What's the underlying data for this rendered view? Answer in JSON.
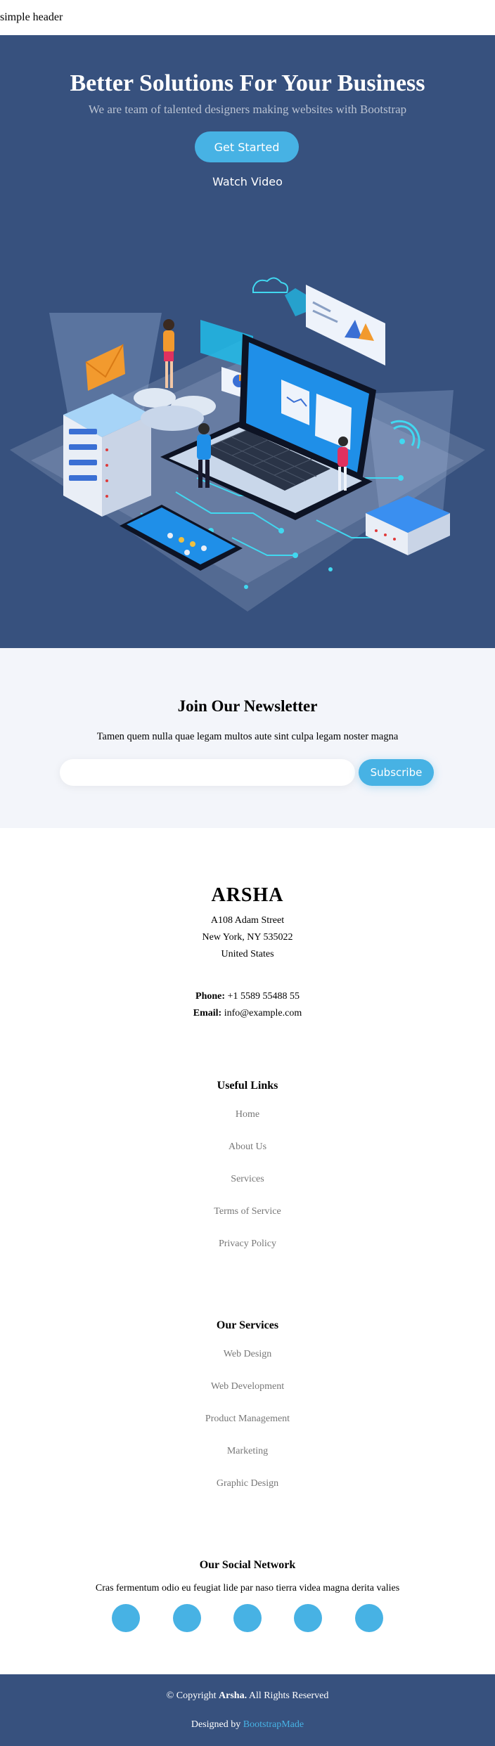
{
  "header": {
    "title": "simple header"
  },
  "hero": {
    "title": "Better Solutions For Your Business",
    "subtitle": "We are team of talented designers making websites with Bootstrap",
    "cta_label": "Get Started",
    "video_label": "Watch Video",
    "art_icon": "isometric-tech-illustration"
  },
  "newsletter": {
    "title": "Join Our Newsletter",
    "text": "Tamen quem nulla quae legam multos aute sint culpa legam noster magna",
    "input_value": "",
    "button_label": "Subscribe"
  },
  "contact": {
    "brand": "ARSHA",
    "address_line1": "A108 Adam Street",
    "address_line2": "New York, NY 535022",
    "address_line3": "United States",
    "phone_label": "Phone:",
    "phone_value": "+1 5589 55488 55",
    "email_label": "Email:",
    "email_value": "info@example.com"
  },
  "useful_links": {
    "title": "Useful Links",
    "items": [
      "Home",
      "About Us",
      "Services",
      "Terms of Service",
      "Privacy Policy"
    ]
  },
  "services": {
    "title": "Our Services",
    "items": [
      "Web Design",
      "Web Development",
      "Product Management",
      "Marketing",
      "Graphic Design"
    ]
  },
  "social": {
    "title": "Our Social Network",
    "text": "Cras fermentum odio eu feugiat lide par naso tierra videa magna derita valies",
    "icons": [
      "twitter-icon",
      "facebook-icon",
      "instagram-icon",
      "skype-icon",
      "linkedin-icon"
    ]
  },
  "footer": {
    "copy_prefix": "© Copyright",
    "copy_brand": "Arsha.",
    "copy_suffix": "All Rights Reserved",
    "credits_prefix": "Designed by",
    "credits_link": "BootstrapMade"
  },
  "colors": {
    "primary": "#37517e",
    "accent": "#47b2e4",
    "light_bg": "#f3f5fa",
    "link_gray": "#777777"
  }
}
